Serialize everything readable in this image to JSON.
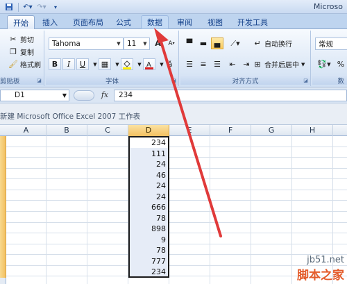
{
  "titlebar": {
    "app_title": "Microso"
  },
  "tabs": [
    {
      "label": "开始"
    },
    {
      "label": "插入"
    },
    {
      "label": "页面布局"
    },
    {
      "label": "公式"
    },
    {
      "label": "数据"
    },
    {
      "label": "审阅"
    },
    {
      "label": "视图"
    },
    {
      "label": "开发工具"
    }
  ],
  "ribbon": {
    "clipboard": {
      "cut": "剪切",
      "copy": "复制",
      "format_painter": "格式刷",
      "label": "剪贴板"
    },
    "font": {
      "name": "Tahoma",
      "size": "11",
      "label": "字体",
      "bold": "B",
      "italic": "I",
      "underline": "U",
      "grow": "A",
      "shrink": "A"
    },
    "alignment": {
      "wrap": "自动换行",
      "merge": "合并后居中",
      "label": "对齐方式"
    },
    "number": {
      "format": "常规",
      "label": "数"
    }
  },
  "formula": {
    "cell_ref": "D1",
    "fx": "fx",
    "content": "234"
  },
  "document": {
    "title": "新建 Microsoft Office Excel 2007 工作表"
  },
  "columns": [
    "A",
    "B",
    "C",
    "D",
    "E",
    "F",
    "G",
    "H"
  ],
  "column_d_values": [
    "234",
    "111",
    "24",
    "46",
    "24",
    "24",
    "666",
    "78",
    "898",
    "9",
    "78",
    "777",
    "234"
  ],
  "watermark": {
    "line1": "jb51.net",
    "line2": "脚本之家"
  },
  "colors": {
    "selection": "#f3c061",
    "arrow": "#e03a3a",
    "ribbon": "#dbe7f6"
  }
}
